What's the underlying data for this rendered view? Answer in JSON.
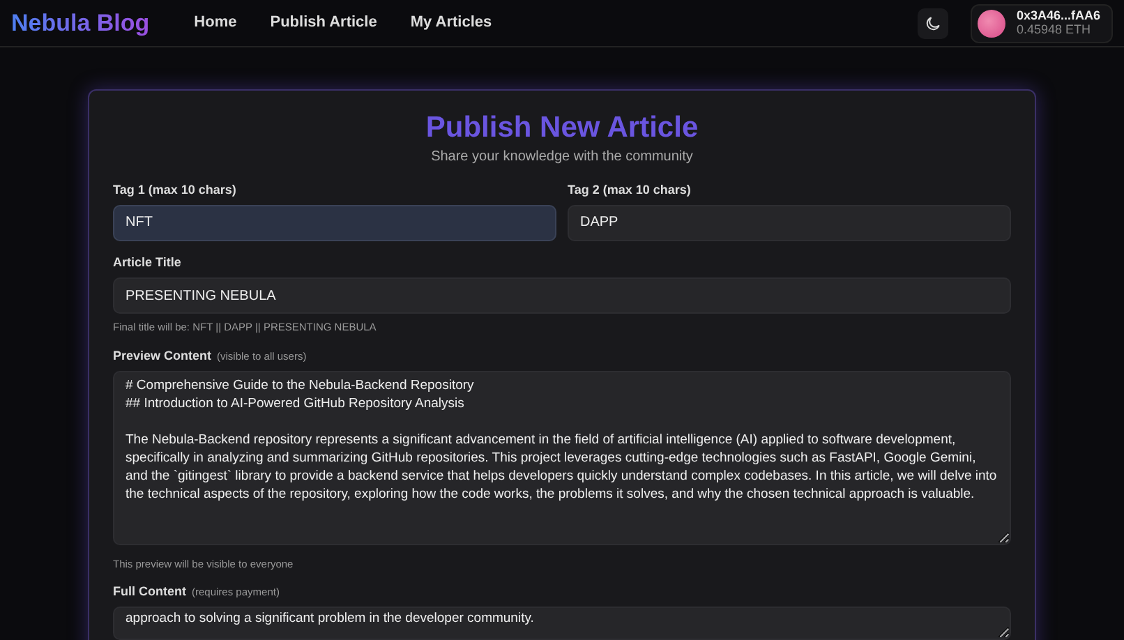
{
  "navbar": {
    "brand": "Nebula Blog",
    "links": [
      {
        "label": "Home"
      },
      {
        "label": "Publish Article"
      },
      {
        "label": "My Articles"
      }
    ],
    "wallet": {
      "address": "0x3A46...fAA6",
      "balance": "0.45948 ETH"
    }
  },
  "form": {
    "title": "Publish New Article",
    "subtitle": "Share your knowledge with the community",
    "tags": [
      {
        "label": "Tag 1 (max 10 chars)",
        "value": "NFT",
        "focused": true
      },
      {
        "label": "Tag 2 (max 10 chars)",
        "value": "DAPP",
        "focused": false
      }
    ],
    "article_title": {
      "label": "Article Title",
      "value": "PRESENTING NEBULA",
      "hint": "Final title will be: NFT || DAPP || PRESENTING NEBULA"
    },
    "preview": {
      "label": "Preview Content",
      "note": "(visible to all users)",
      "value": "# Comprehensive Guide to the Nebula-Backend Repository\n## Introduction to AI-Powered GitHub Repository Analysis\n\nThe Nebula-Backend repository represents a significant advancement in the field of artificial intelligence (AI) applied to software development, specifically in analyzing and summarizing GitHub repositories. This project leverages cutting-edge technologies such as FastAPI, Google Gemini, and the `gitingest` library to provide a backend service that helps developers quickly understand complex codebases. In this article, we will delve into the technical aspects of the repository, exploring how the code works, the problems it solves, and why the chosen technical approach is valuable.",
      "hint": "This preview will be visible to everyone"
    },
    "full": {
      "label": "Full Content",
      "note": "(requires payment)",
      "value": "approach to solving a significant problem in the developer community."
    }
  }
}
